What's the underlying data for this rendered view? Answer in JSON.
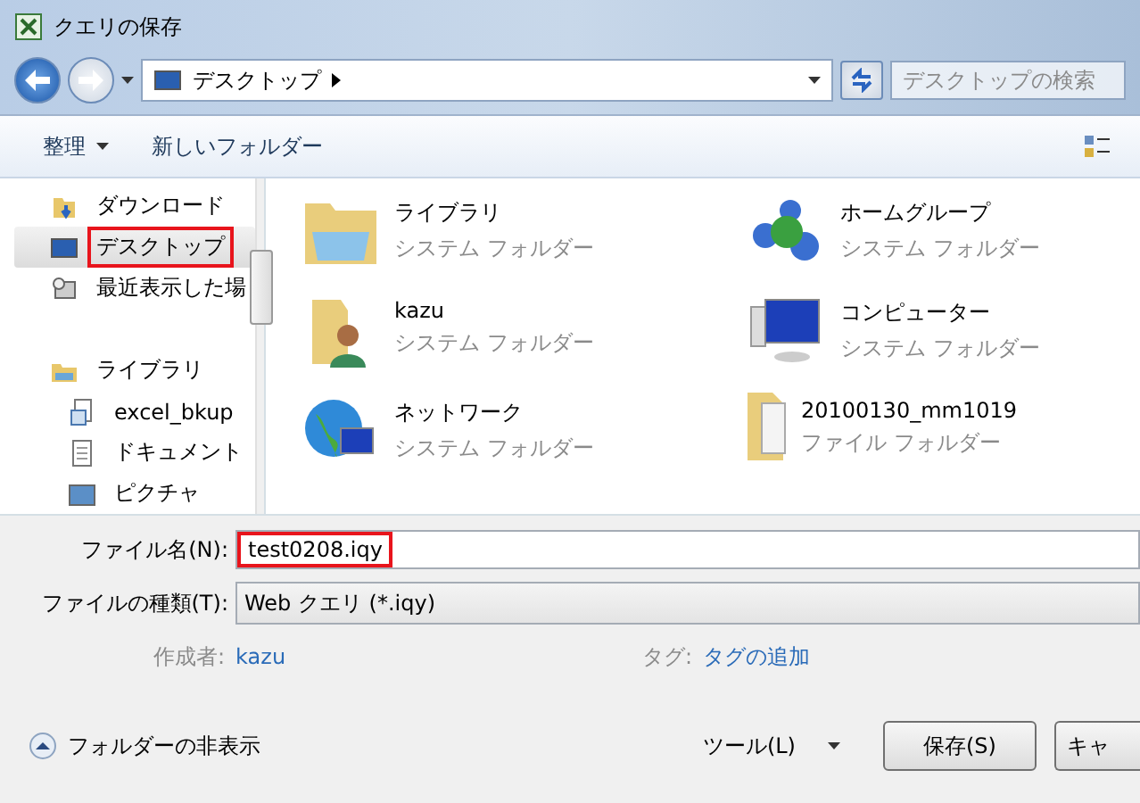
{
  "window": {
    "title": "クエリの保存"
  },
  "address": {
    "location": "デスクトップ",
    "search_placeholder": "デスクトップの検索"
  },
  "toolbar": {
    "organize": "整理",
    "new_folder": "新しいフォルダー"
  },
  "sidebar": {
    "items": [
      {
        "label": "ダウンロード",
        "kind": "download",
        "selected": false,
        "highlighted": false
      },
      {
        "label": "デスクトップ",
        "kind": "desktop",
        "selected": true,
        "highlighted": true
      },
      {
        "label": "最近表示した場",
        "kind": "recent",
        "selected": false,
        "highlighted": false
      },
      {
        "label": "ライブラリ",
        "kind": "library",
        "selected": false,
        "highlighted": false,
        "children": [
          {
            "label": "excel_bkup",
            "kind": "doclib",
            "selected": false,
            "highlighted": false
          },
          {
            "label": "ドキュメント",
            "kind": "document",
            "selected": false,
            "highlighted": false
          },
          {
            "label": "ピクチャ",
            "kind": "picture",
            "selected": false,
            "highlighted": false
          }
        ]
      }
    ]
  },
  "files": [
    {
      "name": "ライブラリ",
      "type": "システム フォルダー",
      "kind": "library"
    },
    {
      "name": "ホームグループ",
      "type": "システム フォルダー",
      "kind": "homegroup"
    },
    {
      "name": "kazu",
      "type": "システム フォルダー",
      "kind": "user"
    },
    {
      "name": "コンピューター",
      "type": "システム フォルダー",
      "kind": "computer"
    },
    {
      "name": "ネットワーク",
      "type": "システム フォルダー",
      "kind": "network"
    },
    {
      "name": "20100130_mm1019",
      "type": "ファイル フォルダー",
      "kind": "folder"
    }
  ],
  "form": {
    "filename_label": "ファイル名(N):",
    "filename": "test0208.iqy",
    "filename_highlighted": true,
    "filetype_label": "ファイルの種類(T):",
    "filetype": "Web クエリ (*.iqy)",
    "author_label": "作成者:",
    "author": "kazu",
    "tags_label": "タグ:",
    "tags": "タグの追加"
  },
  "footer": {
    "hide_folders": "フォルダーの非表示",
    "tools": "ツール(L)",
    "save": "保存(S)",
    "cancel": "キャ"
  }
}
